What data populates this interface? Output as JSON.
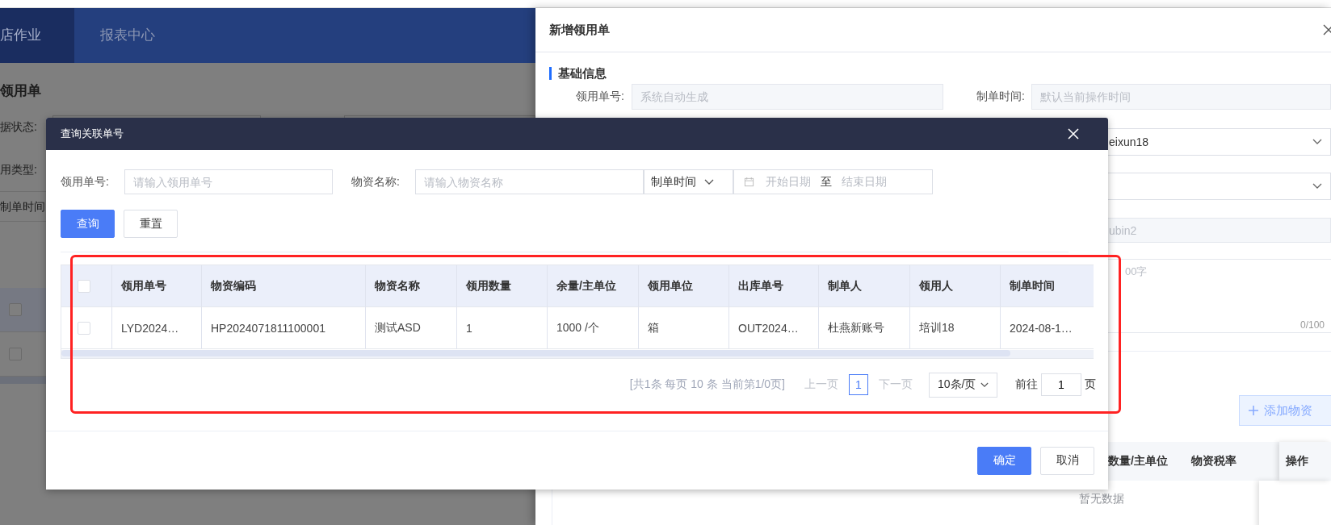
{
  "top_nav": {
    "tabs": [
      {
        "label": "店作业",
        "selected": true
      },
      {
        "label": "报表中心",
        "selected": false
      }
    ]
  },
  "page": {
    "title": "领用单",
    "filters": [
      {
        "label": "据状态:"
      },
      {
        "label": "用类型:"
      }
    ],
    "date_filter": "制单时间",
    "rows": [
      {
        "checked": false
      },
      {
        "checked": false
      }
    ]
  },
  "drawer": {
    "title": "新增领用单",
    "section": "基础信息",
    "fields": [
      {
        "label": "领用单号:",
        "placeholder": "系统自动生成"
      },
      {
        "label": "制单时间:",
        "placeholder": "默认当前操作时间"
      }
    ],
    "partial_fields": [
      {
        "kind": "select",
        "value": "eixun18"
      },
      {
        "kind": "select"
      },
      {
        "kind": "readonly",
        "value": "ubin2"
      }
    ],
    "remark": {
      "placeholder": "00字",
      "counter": "0/100"
    },
    "add_button": "添加物资",
    "table": {
      "columns": [
        "数量/主单位",
        "物资税率"
      ],
      "fixed_column": "操作",
      "empty_text": "暂无数据"
    }
  },
  "dialog": {
    "title": "查询关联单号",
    "filters": [
      {
        "label": "领用单号:",
        "placeholder": "请输入领用单号"
      },
      {
        "label": "物资名称:",
        "placeholder": "请输入物资名称"
      }
    ],
    "date_type": "制单时间",
    "date_range": {
      "start_placeholder": "开始日期",
      "separator": "至",
      "end_placeholder": "结束日期"
    },
    "buttons": [
      {
        "label": "查询",
        "kind": "primary"
      },
      {
        "label": "重置",
        "kind": "default"
      }
    ],
    "table": {
      "all_checked": false,
      "columns": [
        "领用单号",
        "物资编码",
        "物资名称",
        "领用数量",
        "余量/主单位",
        "领用单位",
        "出库单号",
        "制单人",
        "领用人",
        "制单时间"
      ],
      "rows": [
        {
          "checked": false,
          "cells": [
            "LYD2024…",
            "HP2024071811100001",
            "测试ASD",
            "1",
            "1000 /个",
            "箱",
            "OUT2024…",
            "杜燕新账号",
            "培训18",
            "2024-08-1…"
          ]
        }
      ]
    },
    "pagination": {
      "summary": "[共1条 每页 10 条 当前第1/0页]",
      "prev": {
        "label": "上一页",
        "disabled": true
      },
      "pages": [
        {
          "label": "1",
          "selected": true
        }
      ],
      "next": {
        "label": "下一页",
        "disabled": true
      },
      "page_size": "10条/页",
      "jump_label": "前往",
      "jump_value": "1",
      "jump_suffix": "页"
    },
    "annotation": {
      "kind": "rectangle"
    },
    "footer_buttons": [
      {
        "label": "确定",
        "kind": "primary"
      },
      {
        "label": "取消",
        "kind": "default"
      }
    ]
  }
}
